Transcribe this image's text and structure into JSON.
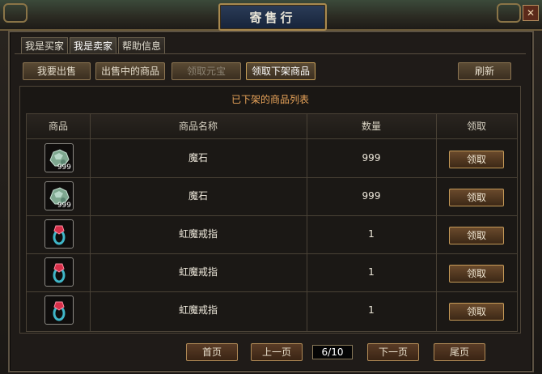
{
  "window": {
    "title": "寄售行"
  },
  "tabs": [
    {
      "label": "我是买家",
      "active": false
    },
    {
      "label": "我是卖家",
      "active": true
    },
    {
      "label": "帮助信息",
      "active": false
    }
  ],
  "toolbar": {
    "sell": "我要出售",
    "on_sale": "出售中的商品",
    "collect_ingot": "领取元宝",
    "collect_delisted": "领取下架商品",
    "refresh": "刷新"
  },
  "panel": {
    "title": "已下架的商品列表"
  },
  "table": {
    "headers": {
      "item": "商品",
      "name": "商品名称",
      "qty": "数量",
      "claim": "领取"
    },
    "rows": [
      {
        "icon": "demon-stone-icon",
        "stack": "999",
        "name": "魔石",
        "qty": "999",
        "claim": "领取"
      },
      {
        "icon": "demon-stone-icon",
        "stack": "999",
        "name": "魔石",
        "qty": "999",
        "claim": "领取"
      },
      {
        "icon": "ring-icon",
        "stack": "",
        "name": "虹魔戒指",
        "qty": "1",
        "claim": "领取"
      },
      {
        "icon": "ring-icon",
        "stack": "",
        "name": "虹魔戒指",
        "qty": "1",
        "claim": "领取"
      },
      {
        "icon": "ring-icon",
        "stack": "",
        "name": "虹魔戒指",
        "qty": "1",
        "claim": "领取"
      }
    ]
  },
  "pagination": {
    "first": "首页",
    "prev": "上一页",
    "indicator": "6/10",
    "next": "下一页",
    "last": "尾页"
  },
  "colors": {
    "accent": "#e9a45a",
    "border": "#c59a58",
    "title_plate": "#16233a"
  }
}
